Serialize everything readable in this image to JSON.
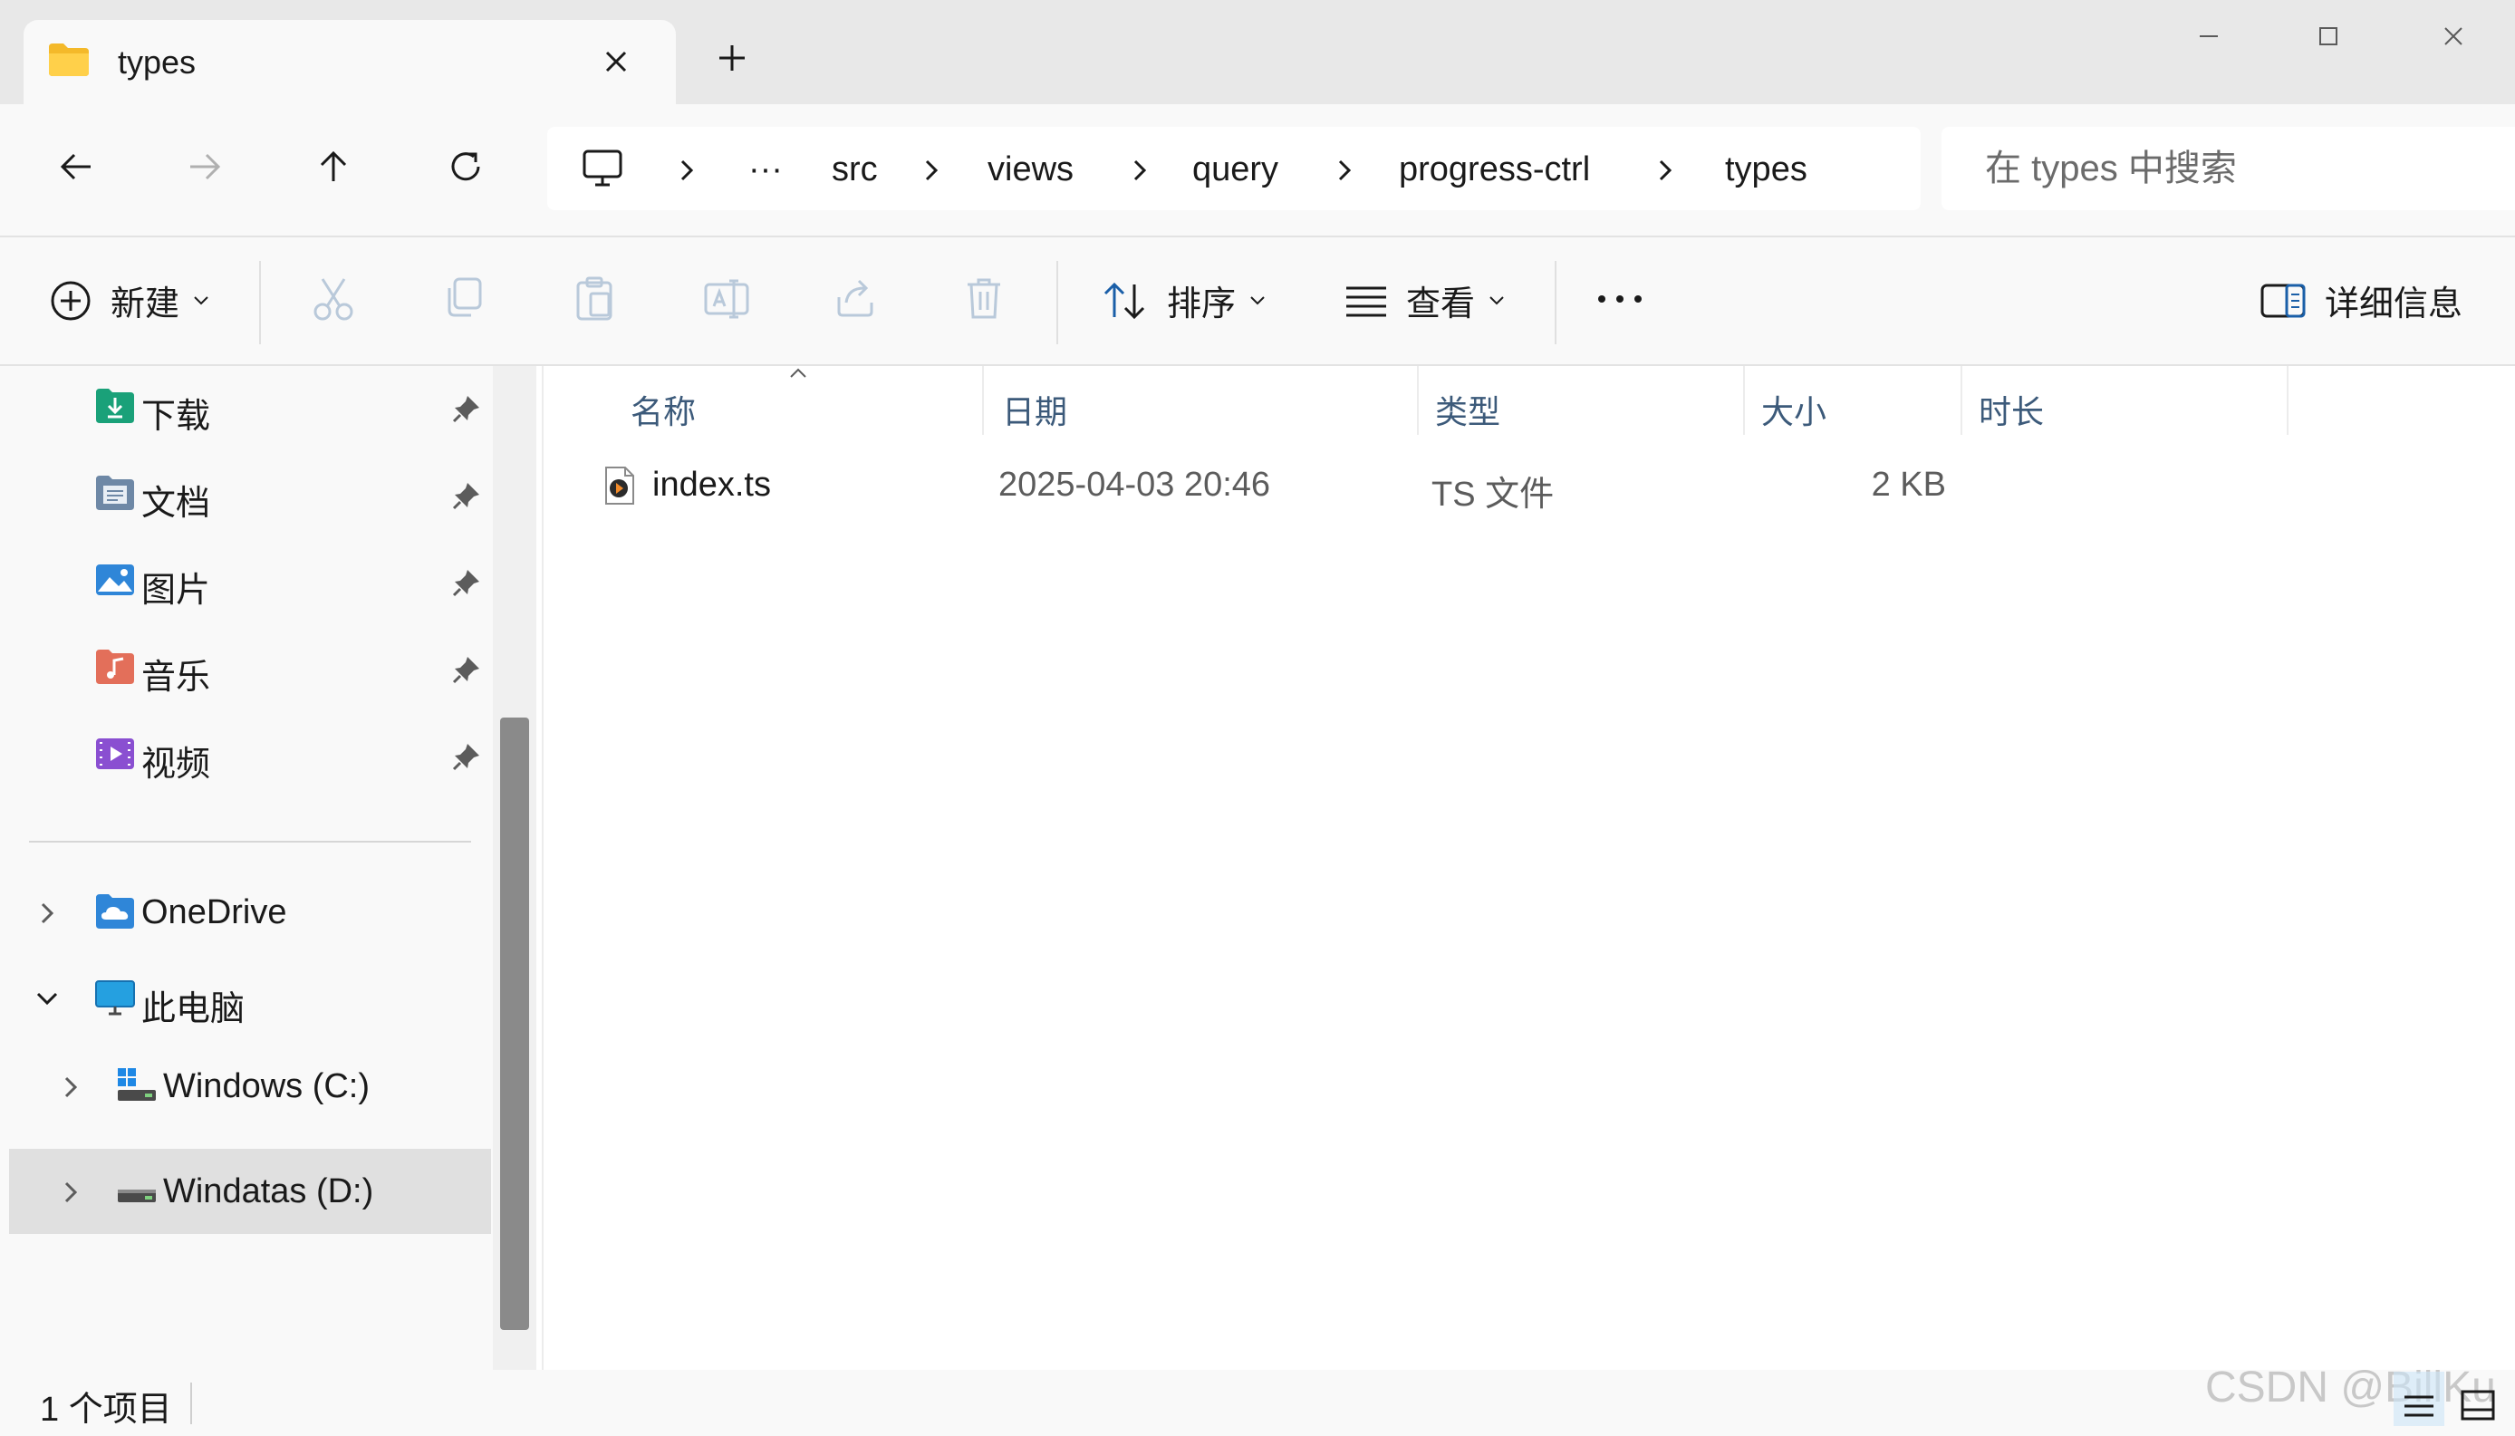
{
  "window": {
    "tab_title": "types",
    "new_tab": "+"
  },
  "breadcrumb": {
    "overflow": "···",
    "items": [
      "src",
      "views",
      "query",
      "progress-ctrl",
      "types"
    ]
  },
  "search": {
    "placeholder": "在 types 中搜索"
  },
  "toolbar": {
    "new_label": "新建",
    "sort_label": "排序",
    "view_label": "查看",
    "details_label": "详细信息"
  },
  "sidebar": {
    "quick_access": [
      {
        "label": "下载",
        "icon": "download-folder-icon",
        "color": "#1aa179"
      },
      {
        "label": "文档",
        "icon": "documents-folder-icon",
        "color": "#6e88a6"
      },
      {
        "label": "图片",
        "icon": "pictures-folder-icon",
        "color": "#2f86d8"
      },
      {
        "label": "音乐",
        "icon": "music-folder-icon",
        "color": "#e36f5a"
      },
      {
        "label": "视频",
        "icon": "videos-folder-icon",
        "color": "#8a4fd1"
      }
    ],
    "tree": [
      {
        "label": "OneDrive",
        "expanded": false
      },
      {
        "label": "此电脑",
        "expanded": true
      },
      {
        "label": "Windows (C:)",
        "expanded": false
      },
      {
        "label": "Windatas (D:)",
        "expanded": false,
        "selected": true
      }
    ]
  },
  "columns": [
    "名称",
    "日期",
    "类型",
    "大小",
    "时长"
  ],
  "files": [
    {
      "name": "index.ts",
      "date": "2025-04-03 20:46",
      "type": "TS 文件",
      "size": "2 KB",
      "duration": ""
    }
  ],
  "status": {
    "item_count": "1 个项目"
  },
  "watermark": "CSDN @BillKu",
  "colors": {
    "accent": "#005fb8",
    "selected_bg": "#e0e0e0",
    "header_text": "#3c5a7a"
  }
}
